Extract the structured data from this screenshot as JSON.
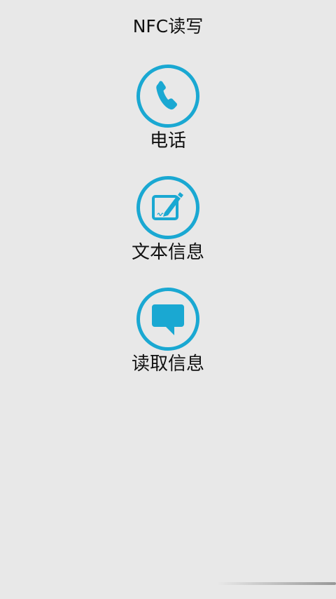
{
  "app": {
    "title": "NFC读写"
  },
  "menu": {
    "items": [
      {
        "label": "电话",
        "icon": "phone-icon"
      },
      {
        "label": "文本信息",
        "icon": "edit-note-icon"
      },
      {
        "label": "读取信息",
        "icon": "chat-bubble-icon"
      }
    ]
  },
  "theme": {
    "accent": "#1aa8d2",
    "background": "#e8e8e8",
    "text": "#111111"
  }
}
